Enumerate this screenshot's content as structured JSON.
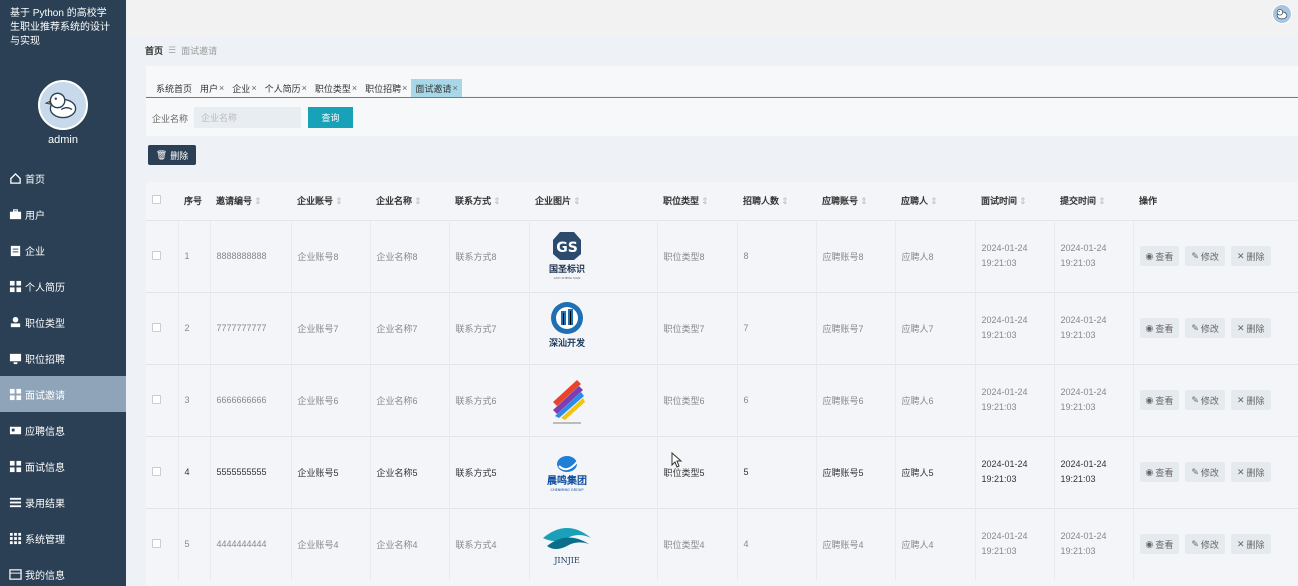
{
  "app": {
    "title": "基于 Python 的高校学生职业推荐系统的设计与实现",
    "username": "admin"
  },
  "sidebar": {
    "items": [
      {
        "label": "首页",
        "icon": "home-icon"
      },
      {
        "label": "用户",
        "icon": "briefcase-icon"
      },
      {
        "label": "企业",
        "icon": "clipboard-icon"
      },
      {
        "label": "个人简历",
        "icon": "grid-icon"
      },
      {
        "label": "职位类型",
        "icon": "user-icon"
      },
      {
        "label": "职位招聘",
        "icon": "monitor-icon"
      },
      {
        "label": "面试邀请",
        "icon": "grid-icon",
        "active": true
      },
      {
        "label": "应聘信息",
        "icon": "id-card-icon"
      },
      {
        "label": "面试信息",
        "icon": "grid-icon"
      },
      {
        "label": "录用结果",
        "icon": "list-icon"
      },
      {
        "label": "系统管理",
        "icon": "apps-icon"
      },
      {
        "label": "我的信息",
        "icon": "window-icon"
      }
    ]
  },
  "breadcrumb": {
    "home": "首页",
    "current": "面试邀请"
  },
  "tabs": [
    {
      "label": "系统首页",
      "closable": false
    },
    {
      "label": "用户",
      "closable": true
    },
    {
      "label": "企业",
      "closable": true
    },
    {
      "label": "个人简历",
      "closable": true
    },
    {
      "label": "职位类型",
      "closable": true
    },
    {
      "label": "职位招聘",
      "closable": true
    },
    {
      "label": "面试邀请",
      "closable": true,
      "active": true
    }
  ],
  "tab_close": "×",
  "search": {
    "label": "企业名称",
    "placeholder": "企业名称",
    "button": "查询"
  },
  "toolbar": {
    "delete_label": "删除",
    "delete_icon": "trash-icon"
  },
  "sort_glyph": "⇕",
  "table": {
    "headers": [
      "序号",
      "邀请编号",
      "企业账号",
      "企业名称",
      "联系方式",
      "企业图片",
      "职位类型",
      "招聘人数",
      "应聘账号",
      "应聘人",
      "面试时间",
      "提交时间",
      "操作"
    ],
    "sortable": [
      false,
      true,
      true,
      true,
      true,
      true,
      true,
      true,
      true,
      true,
      true,
      true,
      false
    ],
    "actions": {
      "view": "查看",
      "edit": "修改",
      "delete": "删除"
    },
    "rows": [
      {
        "no": "1",
        "invite_no": "8888888888",
        "account": "企业账号8",
        "name": "企业名称8",
        "contact": "联系方式8",
        "logo": "guosheng-logo",
        "job_type": "职位类型8",
        "count": "8",
        "apply_account": "应聘账号8",
        "applicant": "应聘人8",
        "interview_time": "2024-01-24 19:21:03",
        "submit_time": "2024-01-24 19:21:03",
        "dark": false
      },
      {
        "no": "2",
        "invite_no": "7777777777",
        "account": "企业账号7",
        "name": "企业名称7",
        "contact": "联系方式7",
        "logo": "shenshan-logo",
        "job_type": "职位类型7",
        "count": "7",
        "apply_account": "应聘账号7",
        "applicant": "应聘人7",
        "interview_time": "2024-01-24 19:21:03",
        "submit_time": "2024-01-24 19:21:03",
        "dark": false
      },
      {
        "no": "3",
        "invite_no": "6666666666",
        "account": "企业账号6",
        "name": "企业名称6",
        "contact": "联系方式6",
        "logo": "stripes-logo",
        "job_type": "职位类型6",
        "count": "6",
        "apply_account": "应聘账号6",
        "applicant": "应聘人6",
        "interview_time": "2024-01-24 19:21:03",
        "submit_time": "2024-01-24 19:21:03",
        "dark": false
      },
      {
        "no": "4",
        "invite_no": "5555555555",
        "account": "企业账号5",
        "name": "企业名称5",
        "contact": "联系方式5",
        "logo": "chenming-logo",
        "job_type": "职位类型5",
        "count": "5",
        "apply_account": "应聘账号5",
        "applicant": "应聘人5",
        "interview_time": "2024-01-24 19:21:03",
        "submit_time": "2024-01-24 19:21:03",
        "dark": true
      },
      {
        "no": "5",
        "invite_no": "4444444444",
        "account": "企业账号4",
        "name": "企业名称4",
        "contact": "联系方式4",
        "logo": "jinjie-logo",
        "job_type": "职位类型4",
        "count": "4",
        "apply_account": "应聘账号4",
        "applicant": "应聘人4",
        "interview_time": "2024-01-24 19:21:03",
        "submit_time": "2024-01-24 19:21:03",
        "dark": false
      }
    ]
  },
  "logo_text": {
    "guosheng": "国圣标识",
    "shenshan": "深汕开发",
    "chenming": "晨鸣集团",
    "jinjie": "JINJIE"
  },
  "colors": {
    "sidebar_bg": "#2b4054",
    "active_menu": "#8fa4b8",
    "accent": "#17a2b8",
    "active_tab": "#a8d8e8"
  }
}
